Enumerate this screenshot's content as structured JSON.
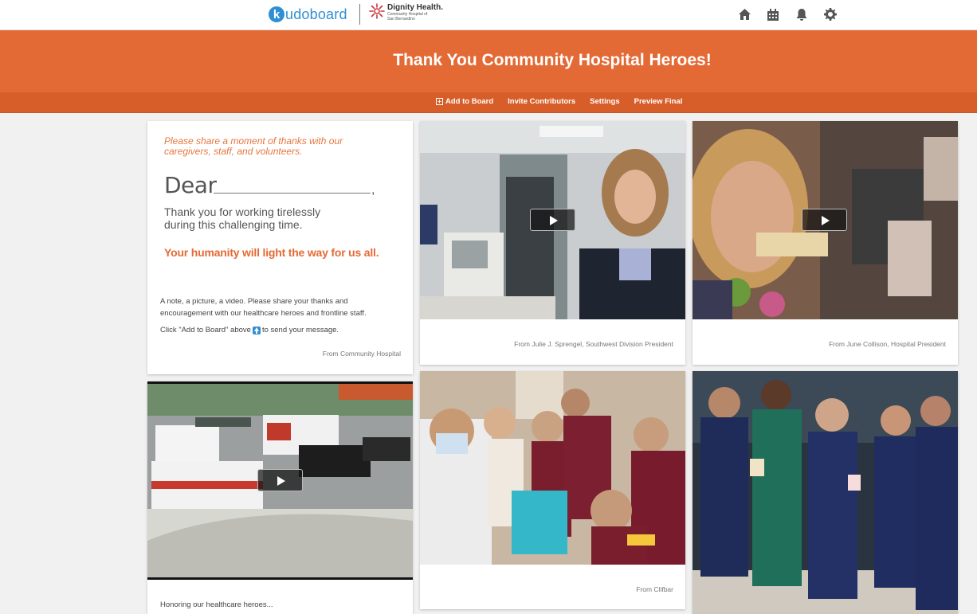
{
  "brand": {
    "logo_letter": "k",
    "logo_word": "udoboard",
    "partner_name": "Dignity Health.",
    "partner_sub1": "Community Hospital of",
    "partner_sub2": "San Bernardino"
  },
  "nav": {
    "icons": [
      "home-icon",
      "calendar-icon",
      "bell-icon",
      "gear-icon"
    ]
  },
  "board": {
    "title": "Thank You Community Hospital Heroes!"
  },
  "toolbar": {
    "plus": "+",
    "add_label": "Add to Board",
    "invite_label": "Invite Contributors",
    "settings_label": "Settings",
    "preview_label": "Preview Final"
  },
  "intro": {
    "prompt": "Please share a moment of thanks with our caregivers, staff, and volunteers.",
    "dear": "Dear",
    "comma": ",",
    "thanks": "Thank you for working tirelessly during this challenging time.",
    "tagline": "Your humanity will light the way for us all.",
    "body": "A note, a picture, a video. Please share your thanks and encouragement with our healthcare heroes and frontline staff.",
    "click_before": "Click \"Add to Board\" above",
    "click_after": "to send your message.",
    "from": "From Community Hospital"
  },
  "posts": [
    {
      "caption": "From Julie J. Sprengel, Southwest Division President"
    },
    {
      "caption": "From June Collison, Hospital President"
    },
    {
      "caption": "Honoring our healthcare heroes..."
    },
    {
      "caption": "From Clifbar"
    }
  ],
  "colors": {
    "banner": "#e46a35",
    "toolbar": "#d85e29",
    "brand_blue": "#2e8fd2"
  }
}
